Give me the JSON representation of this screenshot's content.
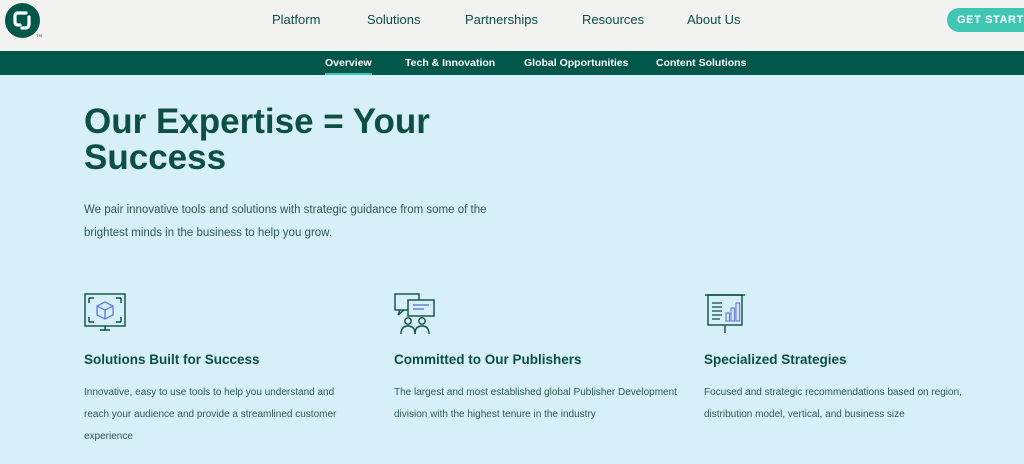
{
  "nav": {
    "items": [
      "Platform",
      "Solutions",
      "Partnerships",
      "Resources",
      "About Us"
    ],
    "cta_label": "GET STARTED"
  },
  "subnav": {
    "items": [
      "Overview",
      "Tech & Innovation",
      "Global Opportunities",
      "Content Solutions"
    ],
    "active": "Overview"
  },
  "hero": {
    "title": "Our Expertise = Your Success",
    "subtitle": "We pair innovative tools and solutions with strategic guidance from some of the brightest minds in the business to help you grow."
  },
  "features": [
    {
      "icon": "box-in-frame-icon",
      "title": "Solutions Built for Success",
      "text": "Innovative, easy to use tools to help you understand and reach your audience and provide a streamlined customer experience"
    },
    {
      "icon": "people-chat-icon",
      "title": "Committed to Our Publishers",
      "text": "The largest and most established global Publisher Development division with the highest tenure in the industry"
    },
    {
      "icon": "presentation-chart-icon",
      "title": "Specialized Strategies",
      "text": "Focused and strategic recommendations based on region, distribution model, vertical, and business size"
    }
  ],
  "colors": {
    "brand_dark": "#00574a",
    "accent": "#3fc7b4",
    "page_background": "#d6eff8",
    "icon_purple": "#6b7fd7"
  }
}
